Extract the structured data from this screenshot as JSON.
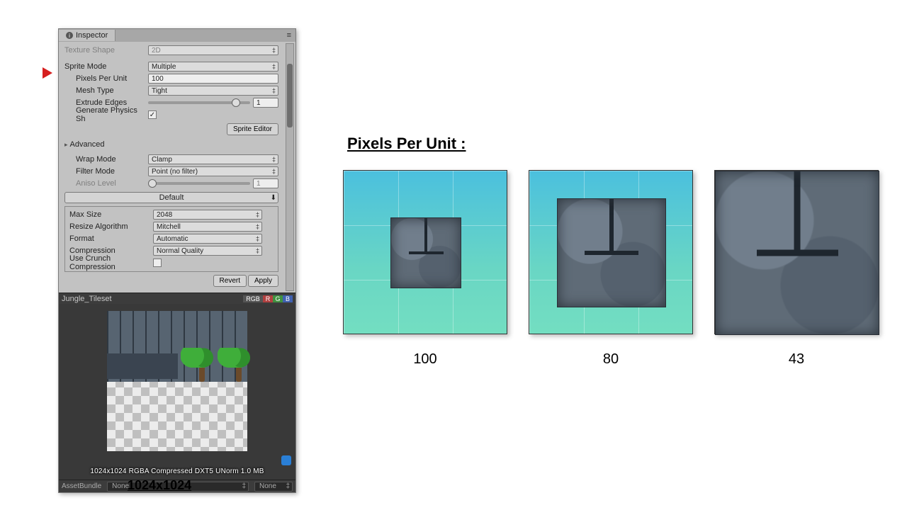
{
  "inspector": {
    "tab_label": "Inspector",
    "texture_shape_label": "Texture Shape",
    "texture_shape_value": "2D",
    "sprite_mode_label": "Sprite Mode",
    "sprite_mode_value": "Multiple",
    "ppu_label": "Pixels Per Unit",
    "ppu_value": "100",
    "mesh_type_label": "Mesh Type",
    "mesh_type_value": "Tight",
    "extrude_label": "Extrude Edges",
    "extrude_value": "1",
    "gen_physics_label": "Generate Physics Sh",
    "gen_physics_checked": "✓",
    "sprite_editor_btn": "Sprite Editor",
    "advanced_label": "Advanced",
    "wrap_mode_label": "Wrap Mode",
    "wrap_mode_value": "Clamp",
    "filter_mode_label": "Filter Mode",
    "filter_mode_value": "Point (no filter)",
    "aniso_label": "Aniso Level",
    "aniso_value": "1",
    "default_label": "Default",
    "maxsize_label": "Max Size",
    "maxsize_value": "2048",
    "resize_label": "Resize Algorithm",
    "resize_value": "Mitchell",
    "format_label": "Format",
    "format_value": "Automatic",
    "compression_label": "Compression",
    "compression_value": "Normal Quality",
    "crunch_label": "Use Crunch Compression",
    "revert_btn": "Revert",
    "apply_btn": "Apply",
    "asset_name": "Jungle_Tileset",
    "rgb_label": "RGB",
    "preview_text": "1024x1024  RGBA Compressed DXT5 UNorm   1.0 MB",
    "assetbundle_label": "AssetBundle",
    "ab_none1": "None",
    "ab_none2": "None"
  },
  "annotations": {
    "dims": "1024x1024",
    "ppu_heading": "Pixels Per Unit :",
    "examples": [
      "100",
      "80",
      "43"
    ]
  }
}
